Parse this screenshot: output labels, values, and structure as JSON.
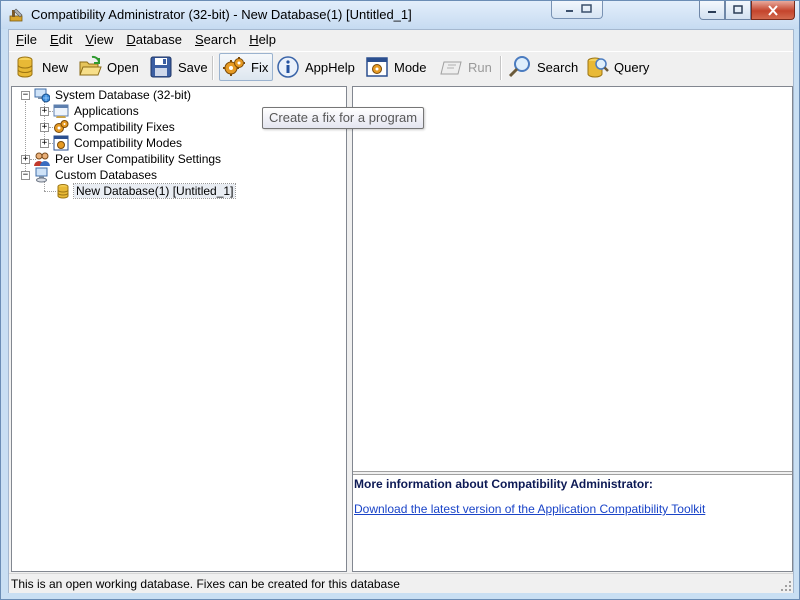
{
  "window": {
    "title": "Compatibility Administrator (32-bit) - New Database(1) [Untitled_1]"
  },
  "menu": {
    "items": [
      {
        "u": "F",
        "rest": "ile"
      },
      {
        "u": "E",
        "rest": "dit"
      },
      {
        "u": "V",
        "rest": "iew"
      },
      {
        "u": "D",
        "rest": "atabase"
      },
      {
        "u": "S",
        "rest": "earch"
      },
      {
        "u": "H",
        "rest": "elp"
      }
    ]
  },
  "toolbar": {
    "new": "New",
    "open": "Open",
    "save": "Save",
    "fix": "Fix",
    "apphelp": "AppHelp",
    "mode": "Mode",
    "run": "Run",
    "search": "Search",
    "query": "Query"
  },
  "tooltip": "Create a fix for a program",
  "tree": {
    "system_db": "System Database (32-bit)",
    "applications": "Applications",
    "fixes": "Compatibility Fixes",
    "modes": "Compatibility Modes",
    "per_user": "Per User Compatibility Settings",
    "custom_db": "Custom Databases",
    "new_db": "New Database(1) [Untitled_1]"
  },
  "info": {
    "title": "More information about Compatibility Administrator:",
    "link": "Download the latest version of the Application Compatibility Toolkit"
  },
  "status": "This is an open working database. Fixes can be created for this database",
  "colors": {
    "title_bg": "#c9dff3",
    "link": "#1a44c8",
    "info_title": "#0d1a55"
  }
}
